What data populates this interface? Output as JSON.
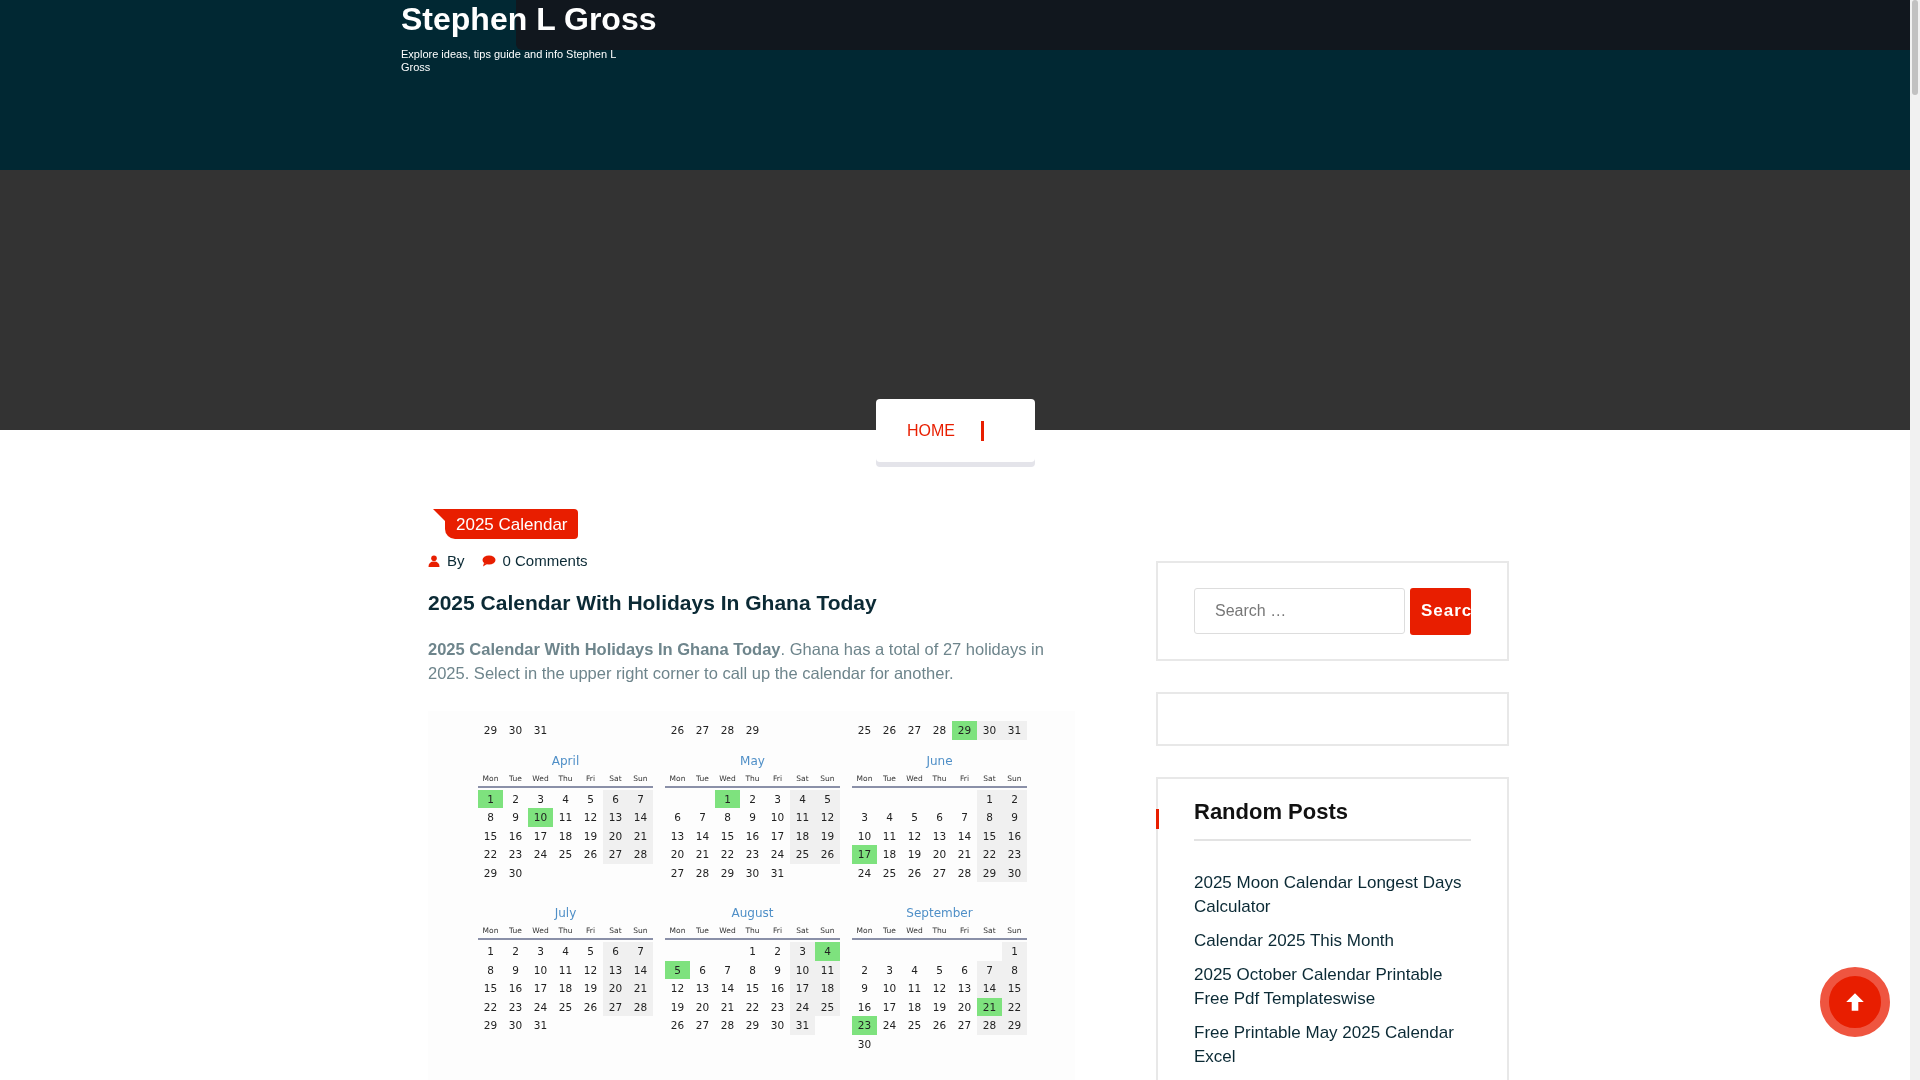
{
  "site": {
    "title": "Stephen L Gross",
    "tagline": "Explore ideas, tips guide and info Stephen L Gross"
  },
  "nav": {
    "items": [
      {
        "label": "HOME",
        "selected": true
      }
    ]
  },
  "post": {
    "category": "2025 Calendar",
    "author_label": "By",
    "comments": "0 Comments",
    "title": "2025 Calendar With Holidays In Ghana Today",
    "excerpt": "**2025 Calendar With Holidays In Ghana Today**. Ghana has a total of 27 holidays in 2025. Select in the upper right corner to call up the calendar for another.",
    "calendar_image": {
      "top_weeks": [
        [
          {
            "kind": "day",
            "d": "29",
            "h": false
          },
          {
            "kind": "day",
            "d": "30",
            "h": false
          },
          {
            "kind": "day",
            "d": "31",
            "h": false
          }
        ],
        [
          {
            "kind": "day",
            "d": "26",
            "h": false
          },
          {
            "kind": "day",
            "d": "27",
            "h": false
          },
          {
            "kind": "day",
            "d": "28",
            "h": false
          },
          {
            "kind": "day",
            "d": "29",
            "h": false
          }
        ],
        [
          {
            "kind": "day",
            "d": "25",
            "h": false
          },
          {
            "kind": "day",
            "d": "26",
            "h": false
          },
          {
            "kind": "day",
            "d": "27",
            "h": false
          },
          {
            "kind": "day",
            "d": "28",
            "h": false
          },
          {
            "kind": "day",
            "d": "29",
            "h": true
          },
          {
            "kind": "day",
            "d": "30",
            "h": false
          },
          {
            "kind": "day",
            "d": "31",
            "h": false
          }
        ]
      ],
      "months": [
        {
          "name": "April",
          "weekdays": [
            "Mon",
            "Tue",
            "Wed",
            "Thu",
            "Fri",
            "Sat",
            "Sun"
          ],
          "weeks": [
            [
              {
                "kind": "day",
                "d": "1",
                "h": true
              },
              {
                "kind": "day",
                "d": "2",
                "h": false
              },
              {
                "kind": "day",
                "d": "3",
                "h": false
              },
              {
                "kind": "day",
                "d": "4",
                "h": false
              },
              {
                "kind": "day",
                "d": "5",
                "h": false
              },
              {
                "kind": "day",
                "d": "6",
                "h": false
              },
              {
                "kind": "day",
                "d": "7",
                "h": false
              }
            ],
            [
              {
                "kind": "day",
                "d": "8",
                "h": false
              },
              {
                "kind": "day",
                "d": "9",
                "h": false
              },
              {
                "kind": "day",
                "d": "10",
                "h": true
              },
              {
                "kind": "day",
                "d": "11",
                "h": false
              },
              {
                "kind": "day",
                "d": "12",
                "h": false
              },
              {
                "kind": "day",
                "d": "13",
                "h": false
              },
              {
                "kind": "day",
                "d": "14",
                "h": false
              }
            ],
            [
              {
                "kind": "day",
                "d": "15",
                "h": false
              },
              {
                "kind": "day",
                "d": "16",
                "h": false
              },
              {
                "kind": "day",
                "d": "17",
                "h": false
              },
              {
                "kind": "day",
                "d": "18",
                "h": false
              },
              {
                "kind": "day",
                "d": "19",
                "h": false
              },
              {
                "kind": "day",
                "d": "20",
                "h": false
              },
              {
                "kind": "day",
                "d": "21",
                "h": false
              }
            ],
            [
              {
                "kind": "day",
                "d": "22",
                "h": false
              },
              {
                "kind": "day",
                "d": "23",
                "h": false
              },
              {
                "kind": "day",
                "d": "24",
                "h": false
              },
              {
                "kind": "day",
                "d": "25",
                "h": false
              },
              {
                "kind": "day",
                "d": "26",
                "h": false
              },
              {
                "kind": "day",
                "d": "27",
                "h": false
              },
              {
                "kind": "day",
                "d": "28",
                "h": false
              }
            ],
            [
              {
                "kind": "day",
                "d": "29",
                "h": false
              },
              {
                "kind": "day",
                "d": "30",
                "h": false
              }
            ]
          ]
        },
        {
          "name": "May",
          "weekdays": [
            "Mon",
            "Tue",
            "Wed",
            "Thu",
            "Fri",
            "Sat",
            "Sun"
          ],
          "weeks": [
            [
              {
                "kind": "blank"
              },
              {
                "kind": "blank"
              },
              {
                "kind": "day",
                "d": "1",
                "h": true
              },
              {
                "kind": "day",
                "d": "2",
                "h": false
              },
              {
                "kind": "day",
                "d": "3",
                "h": false
              },
              {
                "kind": "day",
                "d": "4",
                "h": false
              },
              {
                "kind": "day",
                "d": "5",
                "h": false
              }
            ],
            [
              {
                "kind": "day",
                "d": "6",
                "h": false
              },
              {
                "kind": "day",
                "d": "7",
                "h": false
              },
              {
                "kind": "day",
                "d": "8",
                "h": false
              },
              {
                "kind": "day",
                "d": "9",
                "h": false
              },
              {
                "kind": "day",
                "d": "10",
                "h": false
              },
              {
                "kind": "day",
                "d": "11",
                "h": false
              },
              {
                "kind": "day",
                "d": "12",
                "h": false
              }
            ],
            [
              {
                "kind": "day",
                "d": "13",
                "h": false
              },
              {
                "kind": "day",
                "d": "14",
                "h": false
              },
              {
                "kind": "day",
                "d": "15",
                "h": false
              },
              {
                "kind": "day",
                "d": "16",
                "h": false
              },
              {
                "kind": "day",
                "d": "17",
                "h": false
              },
              {
                "kind": "day",
                "d": "18",
                "h": false
              },
              {
                "kind": "day",
                "d": "19",
                "h": false
              }
            ],
            [
              {
                "kind": "day",
                "d": "20",
                "h": false
              },
              {
                "kind": "day",
                "d": "21",
                "h": false
              },
              {
                "kind": "day",
                "d": "22",
                "h": false
              },
              {
                "kind": "day",
                "d": "23",
                "h": false
              },
              {
                "kind": "day",
                "d": "24",
                "h": false
              },
              {
                "kind": "day",
                "d": "25",
                "h": false
              },
              {
                "kind": "day",
                "d": "26",
                "h": false
              }
            ],
            [
              {
                "kind": "day",
                "d": "27",
                "h": false
              },
              {
                "kind": "day",
                "d": "28",
                "h": false
              },
              {
                "kind": "day",
                "d": "29",
                "h": false
              },
              {
                "kind": "day",
                "d": "30",
                "h": false
              },
              {
                "kind": "day",
                "d": "31",
                "h": false
              }
            ]
          ]
        },
        {
          "name": "June",
          "weekdays": [
            "Mon",
            "Tue",
            "Wed",
            "Thu",
            "Fri",
            "Sat",
            "Sun"
          ],
          "weeks": [
            [
              {
                "kind": "blank"
              },
              {
                "kind": "blank"
              },
              {
                "kind": "blank"
              },
              {
                "kind": "blank"
              },
              {
                "kind": "blank"
              },
              {
                "kind": "day",
                "d": "1",
                "h": false
              },
              {
                "kind": "day",
                "d": "2",
                "h": false
              }
            ],
            [
              {
                "kind": "day",
                "d": "3",
                "h": false
              },
              {
                "kind": "day",
                "d": "4",
                "h": false
              },
              {
                "kind": "day",
                "d": "5",
                "h": false
              },
              {
                "kind": "day",
                "d": "6",
                "h": false
              },
              {
                "kind": "day",
                "d": "7",
                "h": false
              },
              {
                "kind": "day",
                "d": "8",
                "h": false
              },
              {
                "kind": "day",
                "d": "9",
                "h": false
              }
            ],
            [
              {
                "kind": "day",
                "d": "10",
                "h": false
              },
              {
                "kind": "day",
                "d": "11",
                "h": false
              },
              {
                "kind": "day",
                "d": "12",
                "h": false
              },
              {
                "kind": "day",
                "d": "13",
                "h": false
              },
              {
                "kind": "day",
                "d": "14",
                "h": false
              },
              {
                "kind": "day",
                "d": "15",
                "h": false
              },
              {
                "kind": "day",
                "d": "16",
                "h": false
              }
            ],
            [
              {
                "kind": "day",
                "d": "17",
                "h": true
              },
              {
                "kind": "day",
                "d": "18",
                "h": false
              },
              {
                "kind": "day",
                "d": "19",
                "h": false
              },
              {
                "kind": "day",
                "d": "20",
                "h": false
              },
              {
                "kind": "day",
                "d": "21",
                "h": false
              },
              {
                "kind": "day",
                "d": "22",
                "h": false
              },
              {
                "kind": "day",
                "d": "23",
                "h": false
              }
            ],
            [
              {
                "kind": "day",
                "d": "24",
                "h": false
              },
              {
                "kind": "day",
                "d": "25",
                "h": false
              },
              {
                "kind": "day",
                "d": "26",
                "h": false
              },
              {
                "kind": "day",
                "d": "27",
                "h": false
              },
              {
                "kind": "day",
                "d": "28",
                "h": false
              },
              {
                "kind": "day",
                "d": "29",
                "h": false
              },
              {
                "kind": "day",
                "d": "30",
                "h": false
              }
            ]
          ]
        },
        {
          "name": "July",
          "weekdays": [
            "Mon",
            "Tue",
            "Wed",
            "Thu",
            "Fri",
            "Sat",
            "Sun"
          ],
          "weeks": [
            [
              {
                "kind": "day",
                "d": "1",
                "h": false
              },
              {
                "kind": "day",
                "d": "2",
                "h": false
              },
              {
                "kind": "day",
                "d": "3",
                "h": false
              },
              {
                "kind": "day",
                "d": "4",
                "h": false
              },
              {
                "kind": "day",
                "d": "5",
                "h": false
              },
              {
                "kind": "day",
                "d": "6",
                "h": false
              },
              {
                "kind": "day",
                "d": "7",
                "h": false
              }
            ],
            [
              {
                "kind": "day",
                "d": "8",
                "h": false
              },
              {
                "kind": "day",
                "d": "9",
                "h": false
              },
              {
                "kind": "day",
                "d": "10",
                "h": false
              },
              {
                "kind": "day",
                "d": "11",
                "h": false
              },
              {
                "kind": "day",
                "d": "12",
                "h": false
              },
              {
                "kind": "day",
                "d": "13",
                "h": false
              },
              {
                "kind": "day",
                "d": "14",
                "h": false
              }
            ],
            [
              {
                "kind": "day",
                "d": "15",
                "h": false
              },
              {
                "kind": "day",
                "d": "16",
                "h": false
              },
              {
                "kind": "day",
                "d": "17",
                "h": false
              },
              {
                "kind": "day",
                "d": "18",
                "h": false
              },
              {
                "kind": "day",
                "d": "19",
                "h": false
              },
              {
                "kind": "day",
                "d": "20",
                "h": false
              },
              {
                "kind": "day",
                "d": "21",
                "h": false
              }
            ],
            [
              {
                "kind": "day",
                "d": "22",
                "h": false
              },
              {
                "kind": "day",
                "d": "23",
                "h": false
              },
              {
                "kind": "day",
                "d": "24",
                "h": false
              },
              {
                "kind": "day",
                "d": "25",
                "h": false
              },
              {
                "kind": "day",
                "d": "26",
                "h": false
              },
              {
                "kind": "day",
                "d": "27",
                "h": false
              },
              {
                "kind": "day",
                "d": "28",
                "h": false
              }
            ],
            [
              {
                "kind": "day",
                "d": "29",
                "h": false
              },
              {
                "kind": "day",
                "d": "30",
                "h": false
              },
              {
                "kind": "day",
                "d": "31",
                "h": false
              }
            ]
          ]
        },
        {
          "name": "August",
          "weekdays": [
            "Mon",
            "Tue",
            "Wed",
            "Thu",
            "Fri",
            "Sat",
            "Sun"
          ],
          "weeks": [
            [
              {
                "kind": "blank"
              },
              {
                "kind": "blank"
              },
              {
                "kind": "blank"
              },
              {
                "kind": "day",
                "d": "1",
                "h": false
              },
              {
                "kind": "day",
                "d": "2",
                "h": false
              },
              {
                "kind": "day",
                "d": "3",
                "h": false
              },
              {
                "kind": "day",
                "d": "4",
                "h": true
              }
            ],
            [
              {
                "kind": "day",
                "d": "5",
                "h": true
              },
              {
                "kind": "day",
                "d": "6",
                "h": false
              },
              {
                "kind": "day",
                "d": "7",
                "h": false
              },
              {
                "kind": "day",
                "d": "8",
                "h": false
              },
              {
                "kind": "day",
                "d": "9",
                "h": false
              },
              {
                "kind": "day",
                "d": "10",
                "h": false
              },
              {
                "kind": "day",
                "d": "11",
                "h": false
              }
            ],
            [
              {
                "kind": "day",
                "d": "12",
                "h": false
              },
              {
                "kind": "day",
                "d": "13",
                "h": false
              },
              {
                "kind": "day",
                "d": "14",
                "h": false
              },
              {
                "kind": "day",
                "d": "15",
                "h": false
              },
              {
                "kind": "day",
                "d": "16",
                "h": false
              },
              {
                "kind": "day",
                "d": "17",
                "h": false
              },
              {
                "kind": "day",
                "d": "18",
                "h": false
              }
            ],
            [
              {
                "kind": "day",
                "d": "19",
                "h": false
              },
              {
                "kind": "day",
                "d": "20",
                "h": false
              },
              {
                "kind": "day",
                "d": "21",
                "h": false
              },
              {
                "kind": "day",
                "d": "22",
                "h": false
              },
              {
                "kind": "day",
                "d": "23",
                "h": false
              },
              {
                "kind": "day",
                "d": "24",
                "h": false
              },
              {
                "kind": "day",
                "d": "25",
                "h": false
              }
            ],
            [
              {
                "kind": "day",
                "d": "26",
                "h": false
              },
              {
                "kind": "day",
                "d": "27",
                "h": false
              },
              {
                "kind": "day",
                "d": "28",
                "h": false
              },
              {
                "kind": "day",
                "d": "29",
                "h": false
              },
              {
                "kind": "day",
                "d": "30",
                "h": false
              },
              {
                "kind": "day",
                "d": "31",
                "h": false
              }
            ]
          ]
        },
        {
          "name": "September",
          "weekdays": [
            "Mon",
            "Tue",
            "Wed",
            "Thu",
            "Fri",
            "Sat",
            "Sun"
          ],
          "weeks": [
            [
              {
                "kind": "blank"
              },
              {
                "kind": "blank"
              },
              {
                "kind": "blank"
              },
              {
                "kind": "blank"
              },
              {
                "kind": "blank"
              },
              {
                "kind": "blank"
              },
              {
                "kind": "day",
                "d": "1",
                "h": false
              }
            ],
            [
              {
                "kind": "day",
                "d": "2",
                "h": false
              },
              {
                "kind": "day",
                "d": "3",
                "h": false
              },
              {
                "kind": "day",
                "d": "4",
                "h": false
              },
              {
                "kind": "day",
                "d": "5",
                "h": false
              },
              {
                "kind": "day",
                "d": "6",
                "h": false
              },
              {
                "kind": "day",
                "d": "7",
                "h": false
              },
              {
                "kind": "day",
                "d": "8",
                "h": false
              }
            ],
            [
              {
                "kind": "day",
                "d": "9",
                "h": false
              },
              {
                "kind": "day",
                "d": "10",
                "h": false
              },
              {
                "kind": "day",
                "d": "11",
                "h": false
              },
              {
                "kind": "day",
                "d": "12",
                "h": false
              },
              {
                "kind": "day",
                "d": "13",
                "h": false
              },
              {
                "kind": "day",
                "d": "14",
                "h": false
              },
              {
                "kind": "day",
                "d": "15",
                "h": false
              }
            ],
            [
              {
                "kind": "day",
                "d": "16",
                "h": false
              },
              {
                "kind": "day",
                "d": "17",
                "h": false
              },
              {
                "kind": "day",
                "d": "18",
                "h": false
              },
              {
                "kind": "day",
                "d": "19",
                "h": false
              },
              {
                "kind": "day",
                "d": "20",
                "h": false
              },
              {
                "kind": "day",
                "d": "21",
                "h": true
              },
              {
                "kind": "day",
                "d": "22",
                "h": false
              }
            ],
            [
              {
                "kind": "day",
                "d": "23",
                "h": true
              },
              {
                "kind": "day",
                "d": "24",
                "h": false
              },
              {
                "kind": "day",
                "d": "25",
                "h": false
              },
              {
                "kind": "day",
                "d": "26",
                "h": false
              },
              {
                "kind": "day",
                "d": "27",
                "h": false
              },
              {
                "kind": "day",
                "d": "28",
                "h": false
              },
              {
                "kind": "day",
                "d": "29",
                "h": false
              }
            ],
            [
              {
                "kind": "day",
                "d": "30",
                "h": false
              }
            ]
          ]
        }
      ]
    }
  },
  "sidebar": {
    "search": {
      "placeholder": "Search …",
      "button": "Searc"
    },
    "random_posts": {
      "title": "Random Posts",
      "items": [
        "2025 Moon Calendar Longest Days Calculator",
        "Calendar 2025 This Month",
        "2025 October Calendar Printable Free Pdf Templateswise",
        "Free Printable May 2025 Calendar Excel"
      ]
    }
  }
}
